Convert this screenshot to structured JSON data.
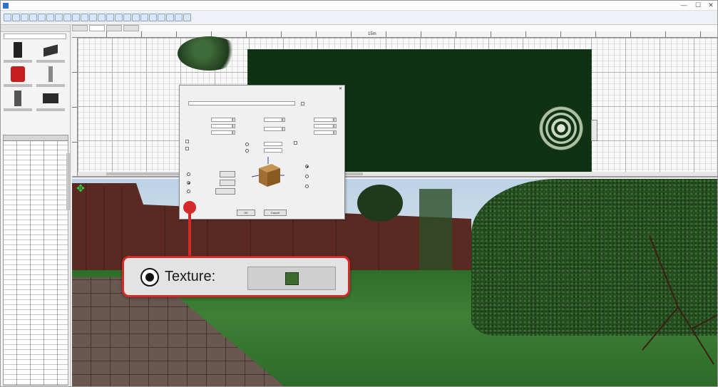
{
  "window": {
    "minimize_glyph": "—",
    "maximize_glyph": "☐",
    "close_glyph": "✕"
  },
  "plan": {
    "ruler_label": "15m"
  },
  "dialog": {
    "close_glyph": "✕",
    "ok_label": "OK",
    "cancel_label": "Cancel"
  },
  "callout": {
    "label": "Texture:"
  },
  "colors": {
    "callout_border": "#d42a2a",
    "lawn_plan": "#0f3312",
    "texture_swatch": "#3e6a2d"
  },
  "icons": [
    "app-icon",
    "move-arrows-icon",
    "radio-selected-icon"
  ]
}
